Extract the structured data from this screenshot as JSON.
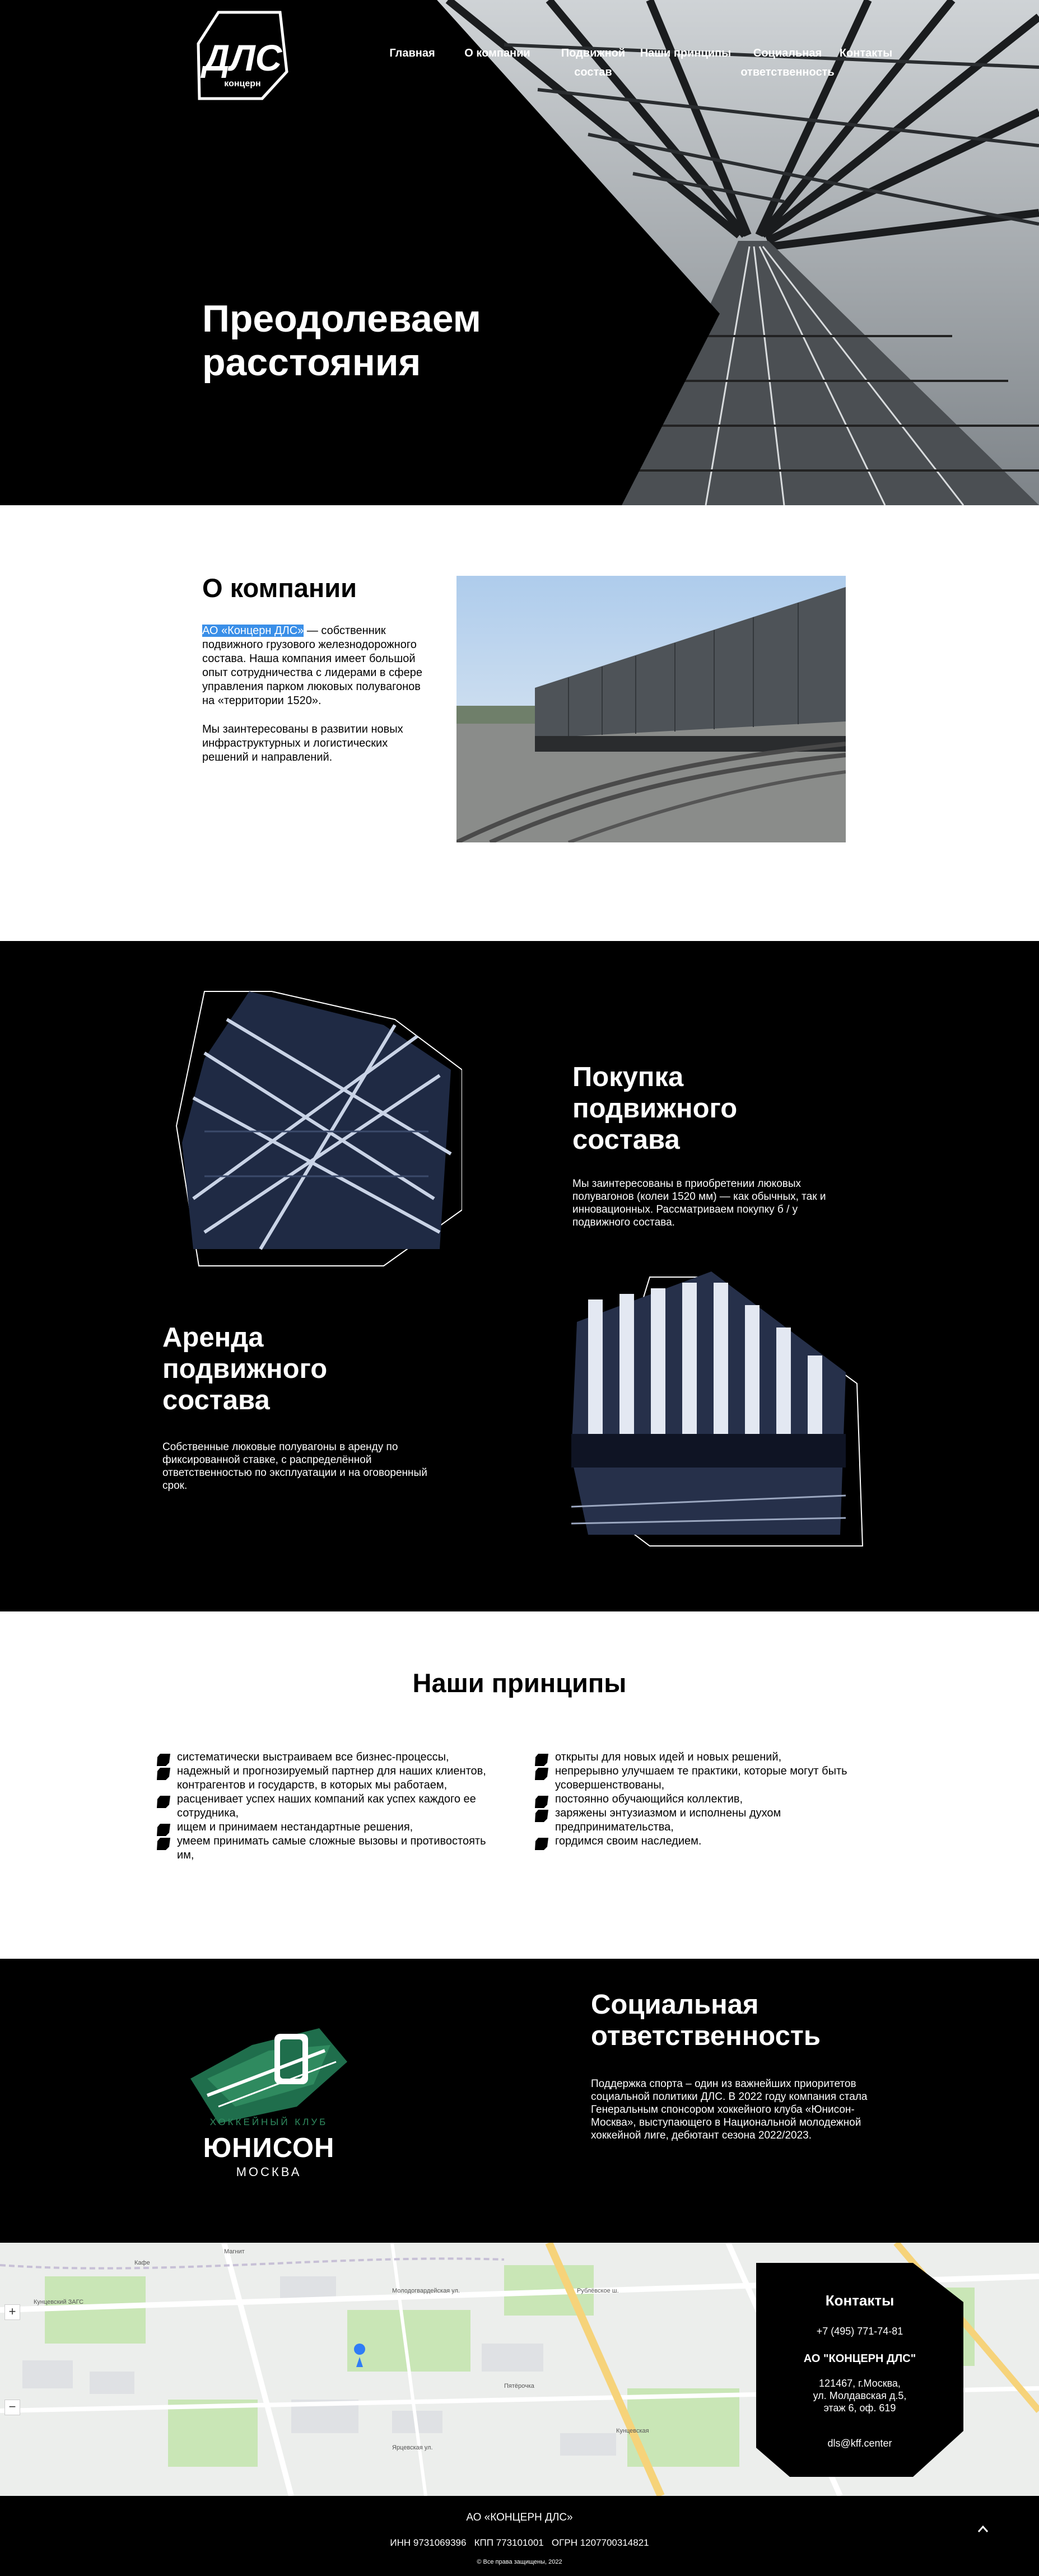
{
  "logo": {
    "text": "ДЛС",
    "sub": "концерн"
  },
  "nav": [
    {
      "label": "Главная"
    },
    {
      "label": "О компании"
    },
    {
      "label_line1": "Подвижной",
      "label_line2": "состав"
    },
    {
      "label": "Наши принципы"
    },
    {
      "label_line1": "Социальная",
      "label_line2": "ответственность"
    },
    {
      "label": "Контакты"
    }
  ],
  "hero": {
    "title_line1": "Преодолеваем",
    "title_line2": "расстояния"
  },
  "about": {
    "title": "О компании",
    "highlight": "АО «Концерн ДЛС»",
    "p1_rest": " — собственник подвижного грузового железнодорожного состава. Наша компания имеет большой опыт сотрудничества с лидерами в сфере управления парком люковых полувагонов на «территории 1520».",
    "p2": "Мы заинтересованы в развитии новых инфраструктурных и логистических решений и направлений."
  },
  "services": {
    "purchase": {
      "title_line1": "Покупка",
      "title_line2": "подвижного",
      "title_line3": "состава",
      "text": "Мы заинтересованы в приобретении люковых полувагонов (колеи 1520 мм) — как обычных, так и инновационных. Рассматриваем покупку б / у подвижного состава."
    },
    "rent": {
      "title_line1": "Аренда",
      "title_line2": "подвижного",
      "title_line3": "состава",
      "text": "Собственные люковые полувагоны в аренду по фиксированной ставке, с распределённой ответственностью по эксплуатации и на оговоренный срок."
    }
  },
  "principles": {
    "title": "Наши принципы",
    "left": [
      "систематически выстраиваем все бизнес-процессы,",
      "надежный и прогнозируемый партнер для наших клиентов, контрагентов и государств, в которых мы работаем,",
      "расценивает успех наших компаний как успех каждого ее сотрудника,",
      "ищем и принимаем нестандартные решения,",
      "умеем принимать самые сложные вызовы и противостоять им,"
    ],
    "right": [
      "открыты для новых идей и новых решений,",
      "непрерывно улучшаем те практики, которые могут быть усовершенствованы,",
      "постоянно обучающийся коллектив,",
      "заряжены энтузиазмом и исполнены духом предпринимательства,",
      "гордимся своим наследием."
    ]
  },
  "social": {
    "title_line1": "Социальная",
    "title_line2": "ответственность",
    "text": "Поддержка спорта – один из важнейших приоритетов социальной политики ДЛС. В 2022 году компания стала Генеральным спонсором хоккейного клуба «Юнисон-Москва», выступающего в Национальной молодежной хоккейной лиге, дебютант сезона 2022/2023.",
    "club_top": "ХОККЕЙНЫЙ КЛУБ",
    "club_name": "ЮНИСОН",
    "club_city": "МОСКВА"
  },
  "map": {
    "labels": [
      "Магнит",
      "Кафе",
      "Кунцевский ЗАГС",
      "Молодогвардейская ул.",
      "Рублёвское ш.",
      "Кунцевская",
      "Ярцевская ул.",
      "Пятёрочка"
    ]
  },
  "contacts": {
    "title": "Контакты",
    "phone": "+7 (495) 771-74-81",
    "company": "АО \"КОНЦЕРН ДЛС\"",
    "address_line1": "121467, г.Москва,",
    "address_line2": "ул. Молдавская д.5,",
    "address_line3": "этаж 6, оф. 619",
    "email": "dls@kff.center"
  },
  "footer": {
    "company": "АО «КОНЦЕРН ДЛС»",
    "requisites": "ИНН 9731069396   КПП 773101001   ОГРН 1207700314821",
    "copyright": "© Все права защищены, 2022"
  }
}
